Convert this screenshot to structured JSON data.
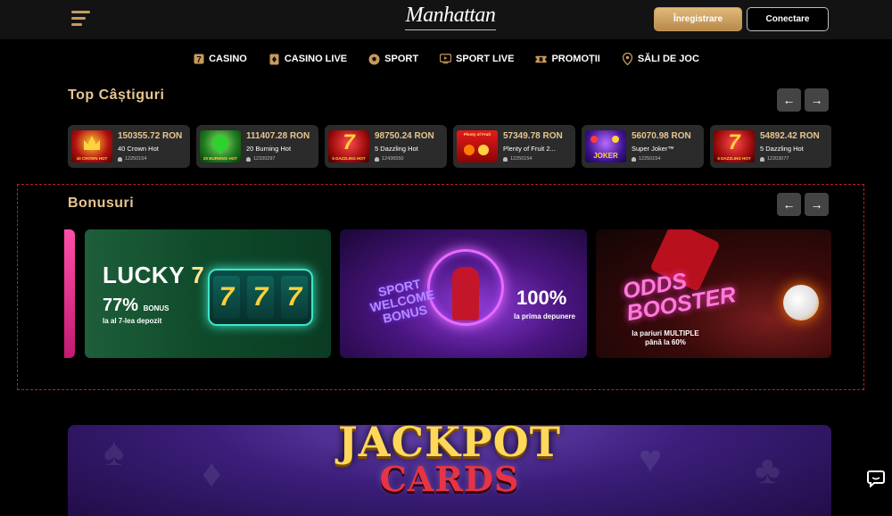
{
  "header": {
    "logo_text": "Manhattan",
    "register_label": "Înregistrare",
    "login_label": "Conectare"
  },
  "nav": [
    {
      "label": "CASINO",
      "icon": "seven-icon"
    },
    {
      "label": "CASINO LIVE",
      "icon": "card-icon"
    },
    {
      "label": "SPORT",
      "icon": "soccer-ball-icon"
    },
    {
      "label": "SPORT LIVE",
      "icon": "tv-icon"
    },
    {
      "label": "PROMOȚII",
      "icon": "ticket-icon"
    },
    {
      "label": "SĂLI DE JOC",
      "icon": "location-pin-icon"
    }
  ],
  "top_wins": {
    "title": "Top Câștiguri",
    "items": [
      {
        "amount": "150355.72 RON",
        "game": "40 Crown Hot",
        "user": "12250154",
        "thumb_label": "40 CROWN HOT"
      },
      {
        "amount": "111407.28 RON",
        "game": "20 Burning Hot",
        "user": "12330297",
        "thumb_label": "20 BURNING HOT"
      },
      {
        "amount": "98750.24 RON",
        "game": "5 Dazzling Hot",
        "user": "12436550",
        "thumb_label": "5 DAZZLING HOT"
      },
      {
        "amount": "57349.78 RON",
        "game": "Plenty of Fruit 2...",
        "user": "12250154",
        "thumb_label": "Plenty of Fruit"
      },
      {
        "amount": "56070.98 RON",
        "game": "Super Joker™",
        "user": "12250154",
        "thumb_label": "JOKER"
      },
      {
        "amount": "54892.42 RON",
        "game": "5 Dazzling Hot",
        "user": "12203077",
        "thumb_label": "5 DAZZLING HOT"
      }
    ]
  },
  "bonuses": {
    "title": "Bonusuri",
    "lucky": {
      "title": "LUCKY",
      "seven": "7",
      "percent": "77%",
      "bonus_word": "BONUS",
      "subtitle": "la al 7-lea depozit",
      "reels": [
        "7",
        "7",
        "7"
      ]
    },
    "sport": {
      "heading": "SPORT WELCOME BONUS",
      "percent": "100%",
      "subtitle": "la prima depunere"
    },
    "odds": {
      "title": "ODDS BOOSTER",
      "subtitle": "la pariuri MULTIPLE până la 60%"
    }
  },
  "jackpot": {
    "title": "JACKPOT",
    "subtitle": "CARDS"
  },
  "colors": {
    "accent_gold": "#e7c591",
    "header_bg": "#131313",
    "card_bg": "#2b2b2b",
    "dashed_border": "#b22222"
  }
}
